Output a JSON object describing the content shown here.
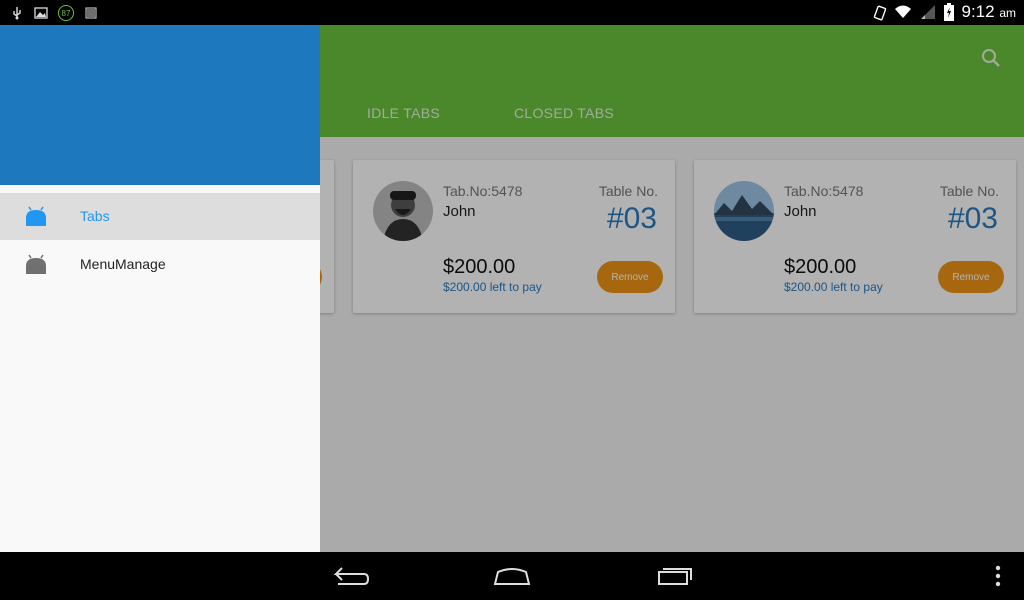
{
  "status_bar": {
    "battery_badge": "87",
    "time": "9:12",
    "ampm": "am",
    "icons": [
      "usb-icon",
      "image-icon",
      "notification-badge",
      "barcode-icon",
      "rotate-icon",
      "wifi-icon",
      "signal-icon",
      "battery-icon"
    ]
  },
  "appbar": {
    "tabs": [
      {
        "label": "IDLE TABS"
      },
      {
        "label": "CLOSED TABS"
      }
    ],
    "color": "#6cc33f",
    "search_icon": "search-icon"
  },
  "cards": [
    {
      "tab_no": "Tab.No:5478",
      "name": "John",
      "table_label": "Table No.",
      "table_num": "#03",
      "amount": "$200.00",
      "left_to_pay": "$200.00 left to pay",
      "button": "Remove",
      "avatar": "person-avatar"
    },
    {
      "tab_no": "Tab.No:5478",
      "name": "John",
      "table_label": "Table No.",
      "table_num": "#03",
      "amount": "$200.00",
      "left_to_pay": "$200.00 left to pay",
      "button": "Remove",
      "avatar": "landscape-avatar"
    }
  ],
  "drawer": {
    "header_color": "#1d78bd",
    "items": [
      {
        "label": "Tabs",
        "icon": "android-icon",
        "active": true
      },
      {
        "label": "MenuManage",
        "icon": "android-icon",
        "active": false
      }
    ]
  },
  "nav_bar": {
    "buttons": [
      "back-icon",
      "home-icon",
      "recents-icon",
      "overflow-menu-icon"
    ]
  },
  "colors": {
    "accent": "#2a7cbf",
    "remove_button": "#ef9416"
  }
}
